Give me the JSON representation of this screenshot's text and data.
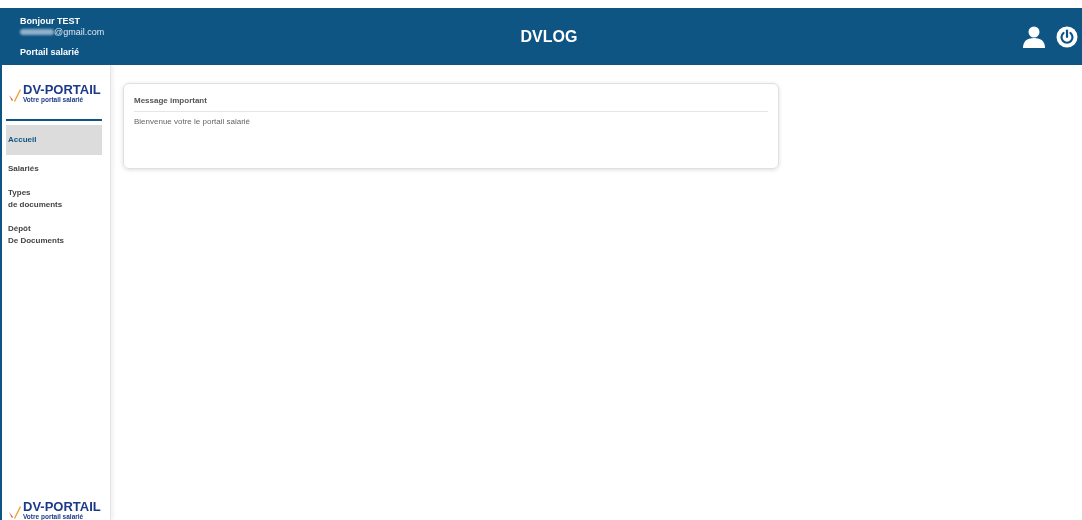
{
  "header": {
    "greeting": "Bonjour TEST",
    "email": "@gmail.com",
    "subtitle": "Portail salarié",
    "title": "DVLOG"
  },
  "sidebar": {
    "logo": {
      "name": "DV-PORTAIL",
      "tagline": "Votre portail salarié"
    },
    "items": [
      {
        "label": "Accueil",
        "selected": true
      },
      {
        "label": "Salariés",
        "selected": false
      },
      {
        "label": "Types\nde documents",
        "selected": false
      },
      {
        "label": "Dépôt\nDe Documents",
        "selected": false
      }
    ],
    "footer_logo": {
      "name": "DV-PORTAIL",
      "tagline": "Votre portail salarié"
    }
  },
  "message_card": {
    "title": "Message important",
    "body": "Bienvenue votre le portail salarié"
  }
}
